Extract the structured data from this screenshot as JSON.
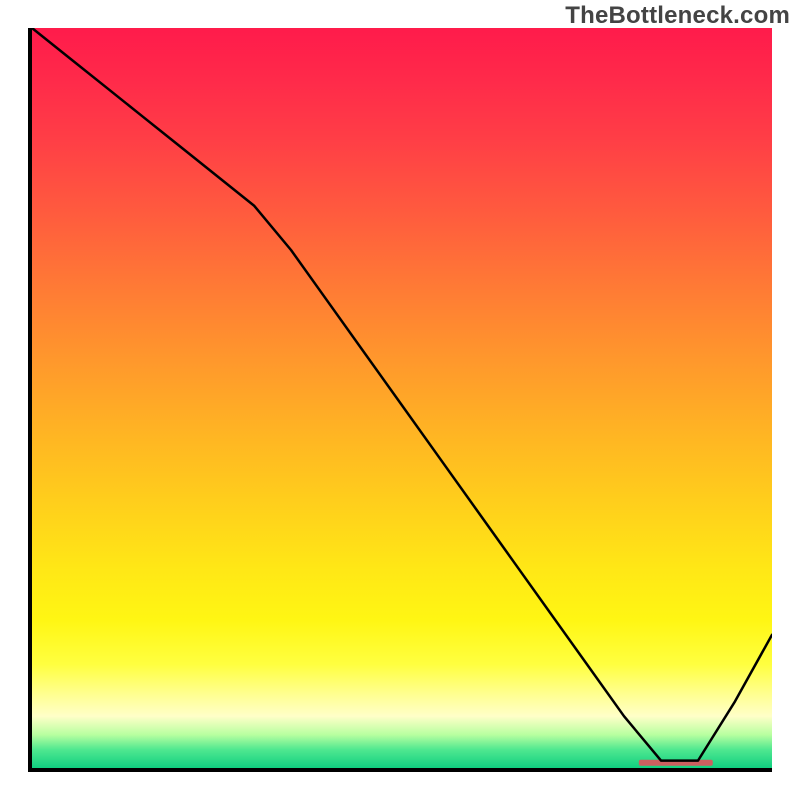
{
  "watermark": "TheBottleneck.com",
  "chart_data": {
    "type": "line",
    "title": "",
    "xlabel": "",
    "ylabel": "",
    "xlim": [
      0,
      100
    ],
    "ylim": [
      0,
      100
    ],
    "grid": false,
    "legend": null,
    "x": [
      0,
      5,
      10,
      15,
      20,
      25,
      30,
      35,
      40,
      45,
      50,
      55,
      60,
      65,
      70,
      75,
      80,
      85,
      90,
      95,
      100
    ],
    "values": [
      100,
      96,
      92,
      88,
      84,
      80,
      76,
      70,
      63,
      56,
      49,
      42,
      35,
      28,
      21,
      14,
      7,
      1,
      1,
      9,
      18
    ],
    "marker_band": {
      "x_start": 82,
      "x_end": 92,
      "y": 0.7,
      "color": "#cc6060"
    },
    "gradient_stops": [
      {
        "offset": 0.0,
        "color": "#ff1b4b"
      },
      {
        "offset": 0.07,
        "color": "#ff2a4a"
      },
      {
        "offset": 0.15,
        "color": "#ff3e46"
      },
      {
        "offset": 0.25,
        "color": "#ff5b3e"
      },
      {
        "offset": 0.35,
        "color": "#ff7a35"
      },
      {
        "offset": 0.45,
        "color": "#ff982c"
      },
      {
        "offset": 0.55,
        "color": "#ffb523"
      },
      {
        "offset": 0.65,
        "color": "#ffd11b"
      },
      {
        "offset": 0.73,
        "color": "#ffe716"
      },
      {
        "offset": 0.8,
        "color": "#fff613"
      },
      {
        "offset": 0.86,
        "color": "#ffff40"
      },
      {
        "offset": 0.9,
        "color": "#ffff90"
      },
      {
        "offset": 0.93,
        "color": "#ffffc8"
      },
      {
        "offset": 0.955,
        "color": "#b8ffa0"
      },
      {
        "offset": 0.975,
        "color": "#50e890"
      },
      {
        "offset": 1.0,
        "color": "#10cf80"
      }
    ]
  }
}
